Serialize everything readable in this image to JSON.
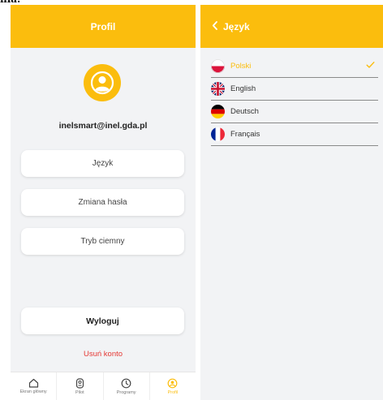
{
  "profile": {
    "header_title": "Profil",
    "email": "inelsmart@inel.gda.pl",
    "buttons": {
      "language": "Język",
      "change_password": "Zmiana hasła",
      "dark_mode": "Tryb ciemny",
      "logout": "Wyloguj"
    },
    "delete_account": "Usuń konto",
    "tabs": [
      {
        "label": "Ekran główny",
        "icon": "home-icon"
      },
      {
        "label": "Pilot",
        "icon": "remote-icon"
      },
      {
        "label": "Programy",
        "icon": "clock-icon"
      },
      {
        "label": "Profil",
        "icon": "profile-icon"
      }
    ]
  },
  "language": {
    "header_title": "Język",
    "back_icon": "chevron-left-icon",
    "options": [
      {
        "label": "Polski",
        "flag": "poland-flag-icon",
        "selected": true
      },
      {
        "label": "English",
        "flag": "uk-flag-icon",
        "selected": false
      },
      {
        "label": "Deutsch",
        "flag": "germany-flag-icon",
        "selected": false
      },
      {
        "label": "Français",
        "flag": "france-flag-icon",
        "selected": false
      }
    ]
  },
  "colors": {
    "accent": "#fbbd0d",
    "background": "#f2f3f5",
    "danger": "#e53935"
  }
}
